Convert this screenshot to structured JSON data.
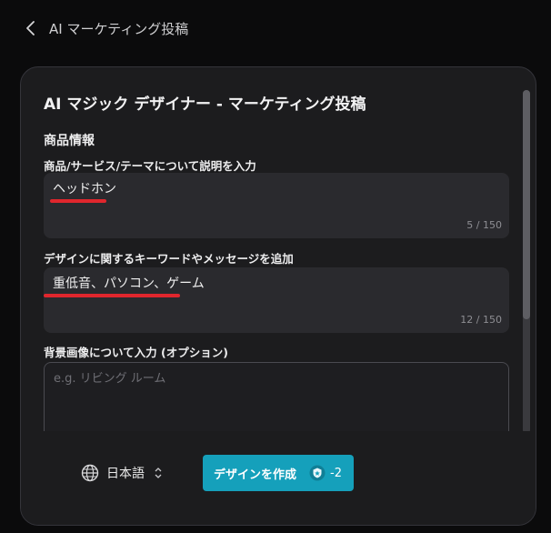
{
  "header": {
    "title": "AI マーケティング投稿"
  },
  "panel": {
    "title": "AI マジック デザイナー - マーケティング投稿",
    "section_title": "商品情報",
    "fields": [
      {
        "label": "商品/サービス/テーマについて説明を入力",
        "value": "ヘッドホン",
        "count": "5 / 150"
      },
      {
        "label": "デザインに関するキーワードやメッセージを追加",
        "value": "重低音、パソコン、ゲーム",
        "count": "12 / 150"
      },
      {
        "label": "背景画像について入力 (オプション)",
        "placeholder": "e.g. リビング ルーム"
      }
    ]
  },
  "footer": {
    "language": "日本語",
    "create_button": "デザインを作成",
    "credit": "-2"
  },
  "colors": {
    "accent": "#15a0bb",
    "annotation_underline": "#e0262d",
    "panel_bg": "#1c1c1e"
  }
}
